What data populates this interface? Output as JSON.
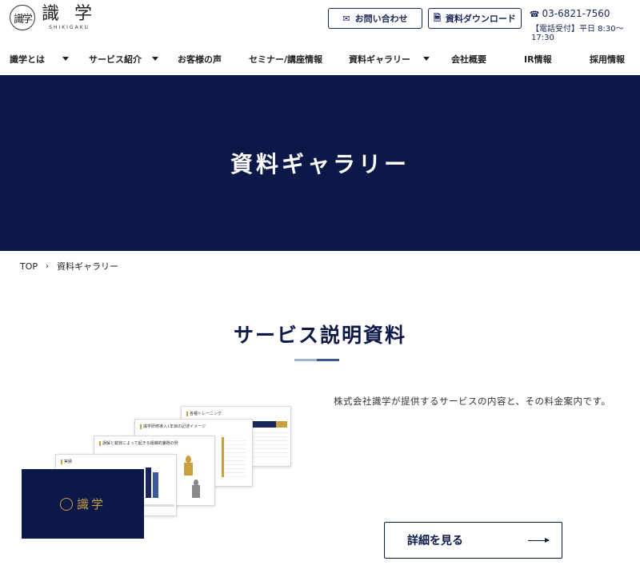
{
  "header": {
    "logo_seal_text": "識学",
    "logo_main": "識 学",
    "logo_sub": "SHIKIGAKU",
    "contact_button": "お問い合わせ",
    "download_button": "資料ダウンロード",
    "phone": "03-6821-7560",
    "hours": "【電話受付】平日 8:30〜17:30"
  },
  "nav": {
    "items": [
      {
        "label": "識学とは"
      },
      {
        "label": "サービス紹介"
      },
      {
        "label": "お客様の声"
      },
      {
        "label": "セミナー/講座情報"
      },
      {
        "label": "資料ギャラリー"
      },
      {
        "label": "会社概要"
      },
      {
        "label": "IR情報"
      },
      {
        "label": "採用情報"
      }
    ]
  },
  "hero": {
    "title": "資料ギャラリー"
  },
  "breadcrumb": {
    "home": "TOP",
    "sep": "›",
    "current": "資料ギャラリー"
  },
  "section": {
    "title": "サービス説明資料",
    "description": "株式会社識学が提供するサービスの内容と、その料金案内です。",
    "detail_button": "詳細を見る"
  },
  "thumbnails": {
    "slide1_title": "各種トレーニング",
    "slide2_title": "識学研修導入1年目の記述イメージ",
    "slide3_title": "誤解と錯覚によって起きる組織的課題の例",
    "slide4_title": "実績",
    "cover_title": "識学"
  },
  "colors": {
    "navy": "#0c1847",
    "accent": "#1a2558",
    "gold": "#c9a040"
  }
}
